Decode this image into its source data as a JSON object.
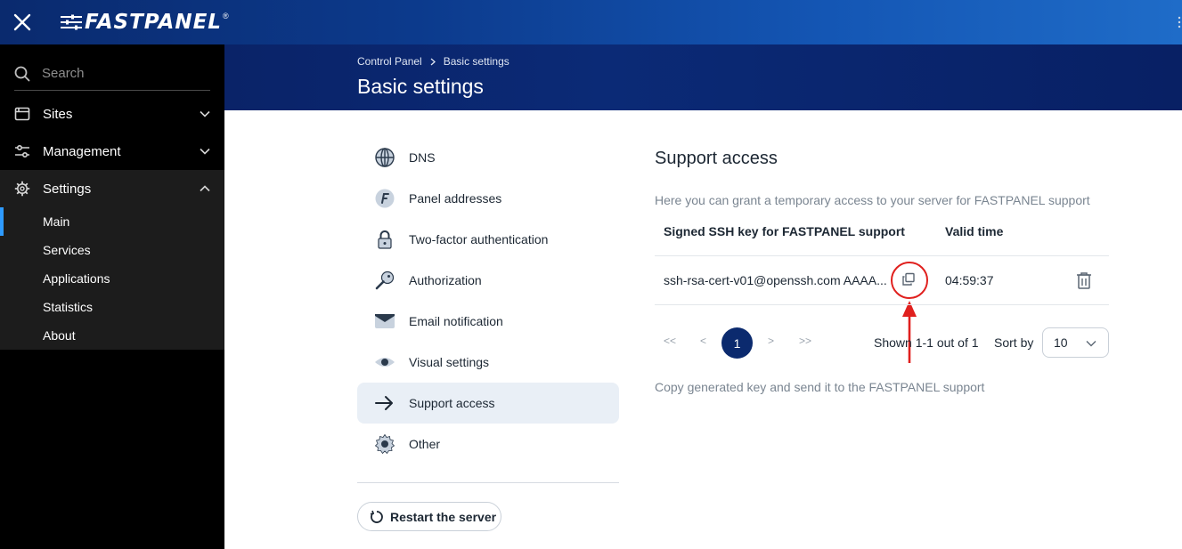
{
  "app": {
    "logo_text": "FASTPANEL",
    "logo_reg": "®"
  },
  "sidebar": {
    "search_placeholder": "Search",
    "items": [
      {
        "label": "Sites"
      },
      {
        "label": "Management"
      },
      {
        "label": "Settings"
      }
    ],
    "settings_sub": [
      {
        "label": "Main"
      },
      {
        "label": "Services"
      },
      {
        "label": "Applications"
      },
      {
        "label": "Statistics"
      },
      {
        "label": "About"
      }
    ]
  },
  "header": {
    "breadcrumb": [
      "Control Panel",
      "Basic settings"
    ],
    "title": "Basic settings"
  },
  "settings_menu": [
    {
      "label": "DNS",
      "icon": "globe-icon"
    },
    {
      "label": "Panel addresses",
      "icon": "panel-f-icon"
    },
    {
      "label": "Two-factor authentication",
      "icon": "lock-icon"
    },
    {
      "label": "Authorization",
      "icon": "key-icon"
    },
    {
      "label": "Email notification",
      "icon": "envelope-icon"
    },
    {
      "label": "Visual settings",
      "icon": "eye-icon"
    },
    {
      "label": "Support access",
      "icon": "arrow-right-icon",
      "active": true
    },
    {
      "label": "Other",
      "icon": "gear-icon"
    }
  ],
  "restart_label": "Restart the server",
  "support": {
    "title": "Support access",
    "description": "Here you can grant a temporary access to your server for FASTPANEL support",
    "columns": [
      "Signed SSH key for FASTPANEL support",
      "Valid time"
    ],
    "rows": [
      {
        "key": "ssh-rsa-cert-v01@openssh.com AAAA...",
        "valid_time": "04:59:37"
      }
    ],
    "pager": {
      "first": "<<",
      "prev": "<",
      "current": "1",
      "next": ">",
      "last": ">>"
    },
    "shown_text": "Shown 1-1 out of 1",
    "sort_label": "Sort by",
    "sort_value": "10",
    "footnote": "Copy generated key and send it to the FASTPANEL support"
  },
  "colors": {
    "accent": "#2e9bff",
    "brand_dark": "#0b2a6e",
    "annotation_red": "#e0201e"
  }
}
